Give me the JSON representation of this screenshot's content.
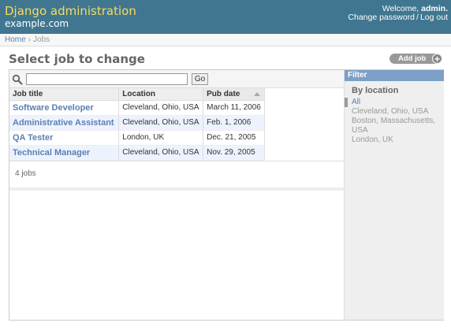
{
  "header": {
    "site_title": "Django administration",
    "site_domain": "example.com",
    "welcome_prefix": "Welcome,",
    "username": "admin.",
    "change_password": "Change password",
    "separator": "/",
    "logout": "Log out"
  },
  "breadcrumbs": {
    "home": "Home",
    "arrow": "›",
    "current": "Jobs"
  },
  "page": {
    "title": "Select job to change",
    "add_button": "Add job",
    "add_icon": "+"
  },
  "search": {
    "value": "",
    "go_label": "Go"
  },
  "table": {
    "columns": [
      "Job title",
      "Location",
      "Pub date"
    ],
    "sorted_column": "Pub date",
    "rows": [
      {
        "title": "Software Developer",
        "location": "Cleveland, Ohio, USA",
        "pub_date": "March 11, 2006"
      },
      {
        "title": "Administrative Assistant",
        "location": "Cleveland, Ohio, USA",
        "pub_date": "Feb. 1, 2006"
      },
      {
        "title": "QA Tester",
        "location": "London, UK",
        "pub_date": "Dec. 21, 2005"
      },
      {
        "title": "Technical Manager",
        "location": "Cleveland, Ohio, USA",
        "pub_date": "Nov. 29, 2005"
      }
    ],
    "result_count": "4 jobs"
  },
  "filter": {
    "header": "Filter",
    "heading": "By location",
    "options": [
      {
        "label": "All",
        "selected": true
      },
      {
        "label": "Cleveland, Ohio, USA",
        "selected": false
      },
      {
        "label": "Boston, Massachusetts, USA",
        "selected": false
      },
      {
        "label": "London, UK",
        "selected": false
      }
    ]
  },
  "colors": {
    "header_bg": "#417690",
    "site_title": "#f5dd5d",
    "link": "#5b80b2",
    "filter_header": "#7ca0c7",
    "row_alt": "#edf3fe"
  }
}
